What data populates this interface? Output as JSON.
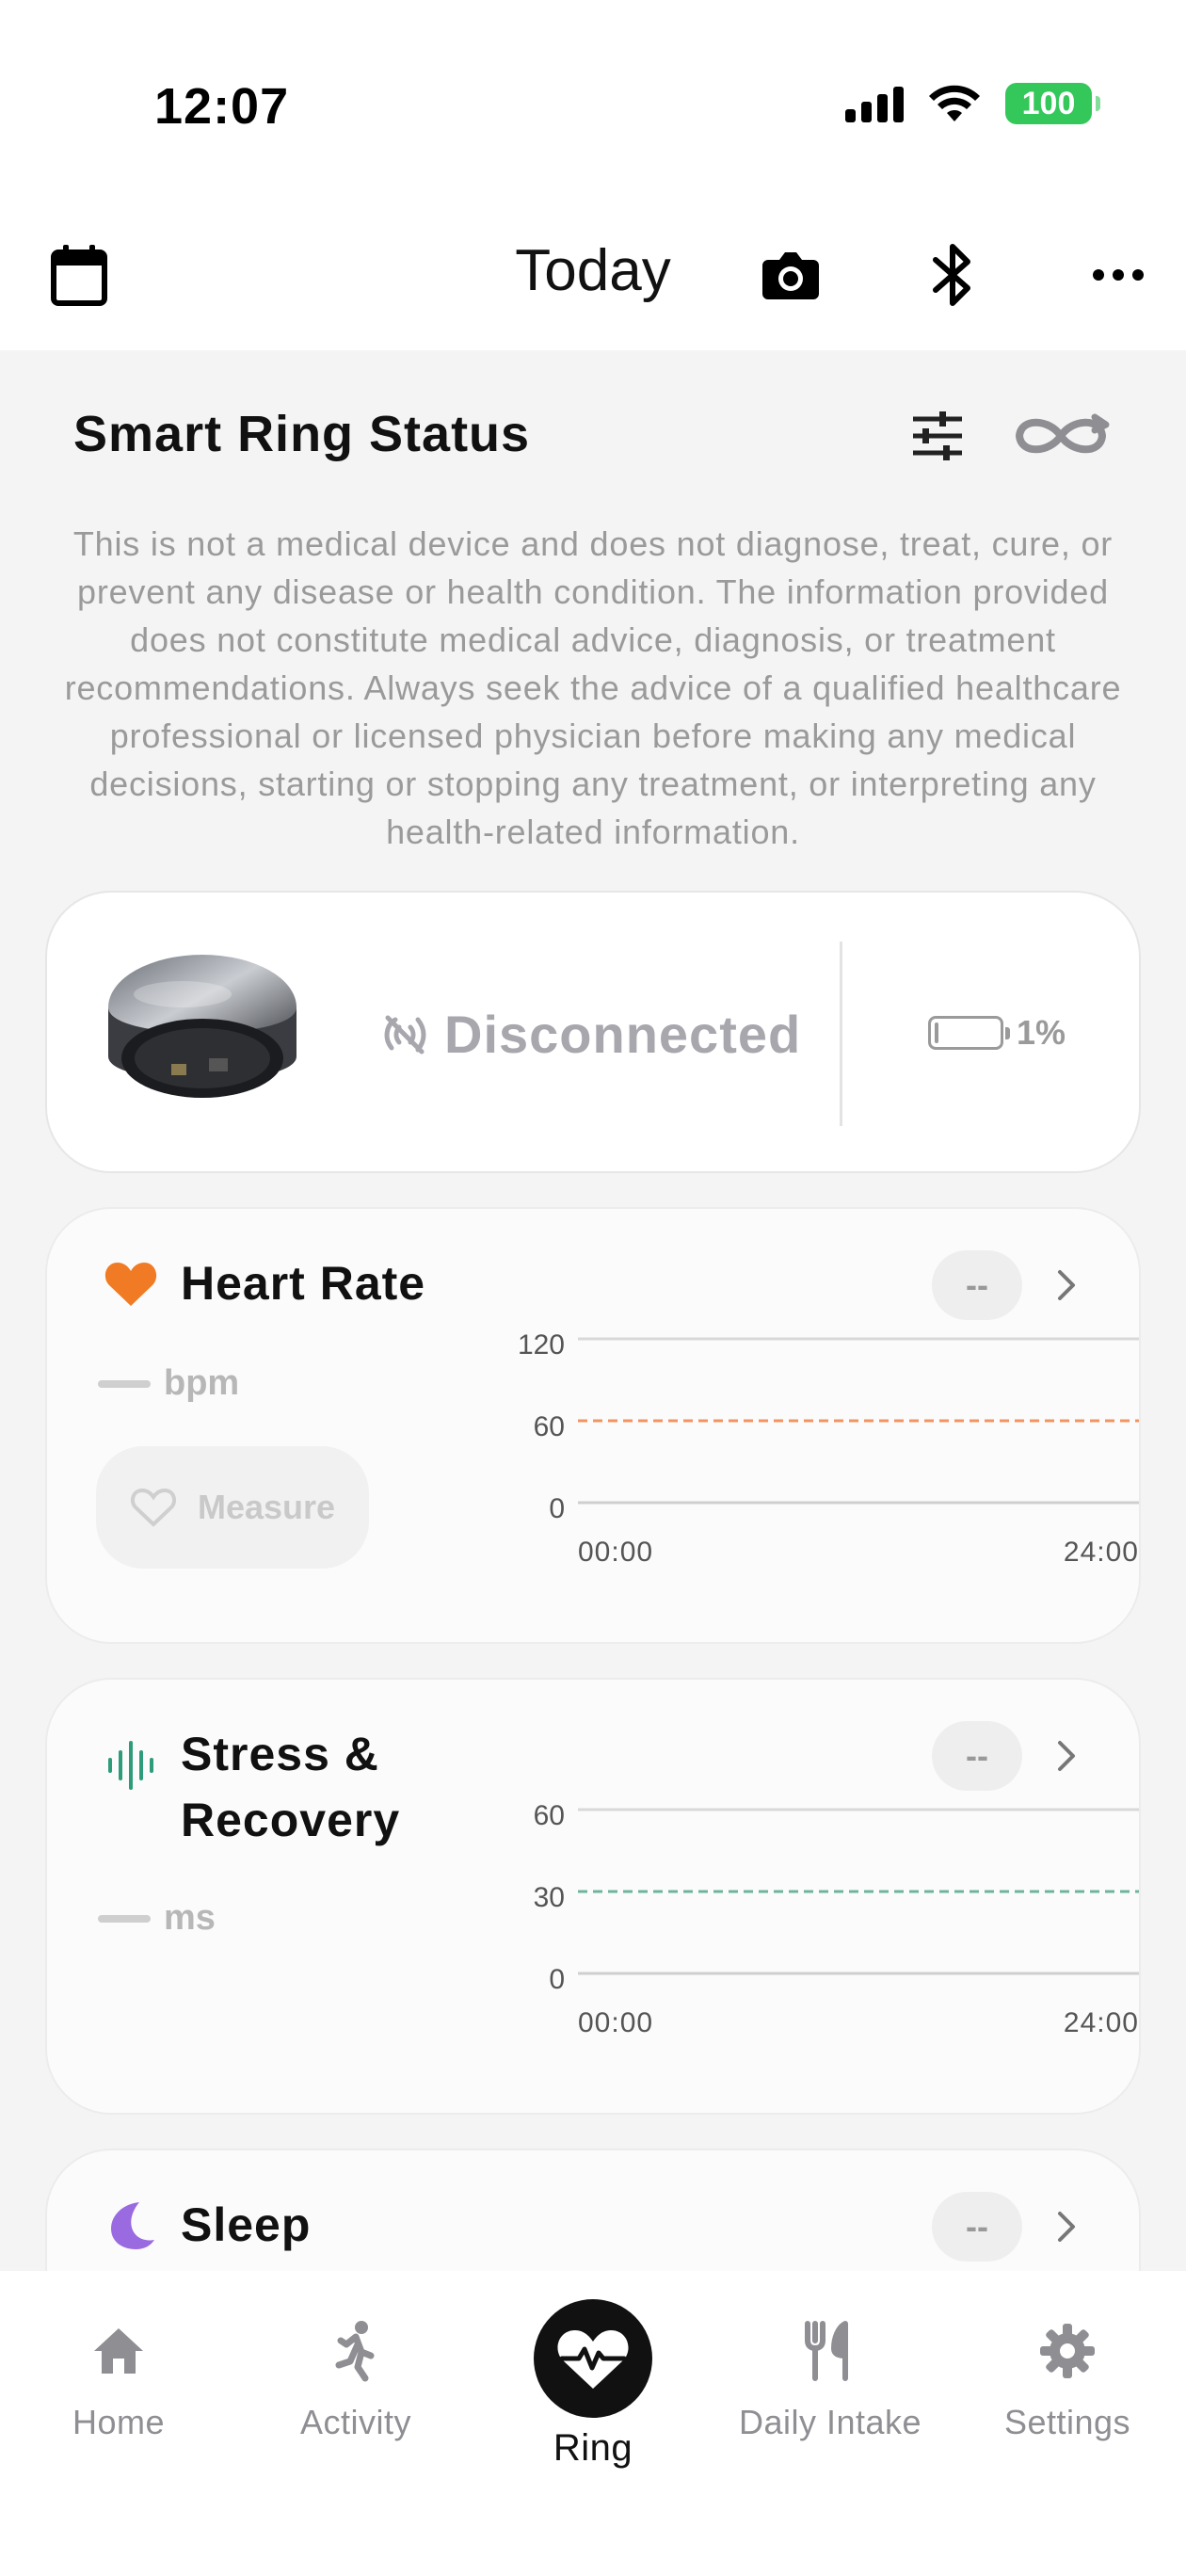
{
  "status_bar": {
    "time": "12:07",
    "battery": "100"
  },
  "header": {
    "title": "Today"
  },
  "section": {
    "title": "Smart Ring Status"
  },
  "disclaimer": "This is not a medical device and does not diagnose, treat, cure, or prevent any disease or health condition. The information provided does not constitute medical advice, diagnosis, or treatment recommendations. Always seek the advice of a qualified healthcare professional or licensed physician before making any medical decisions, starting or stopping any treatment, or interpreting any health-related information.",
  "ring": {
    "status": "Disconnected",
    "battery": "1%"
  },
  "heart_rate": {
    "title": "Heart Rate",
    "value": "--",
    "unit": "bpm",
    "measure_label": "Measure",
    "chart": {
      "y_ticks": [
        "120",
        "60",
        "0"
      ],
      "x_ticks": [
        "00:00",
        "24:00"
      ],
      "color": "#f07b3c"
    }
  },
  "stress": {
    "title_line1": "Stress &",
    "title_line2": "Recovery",
    "value": "--",
    "unit": "ms",
    "chart": {
      "y_ticks": [
        "60",
        "30",
        "0"
      ],
      "x_ticks": [
        "00:00",
        "24:00"
      ],
      "color": "#4aa386"
    }
  },
  "sleep": {
    "title": "Sleep",
    "value": "--"
  },
  "nav": {
    "home": "Home",
    "activity": "Activity",
    "ring": "Ring",
    "daily_intake": "Daily Intake",
    "settings": "Settings"
  },
  "colors": {
    "heart": "#f07b24",
    "stress": "#2e9c7a",
    "sleep": "#9a6ae0",
    "battery_green": "#34c759"
  }
}
